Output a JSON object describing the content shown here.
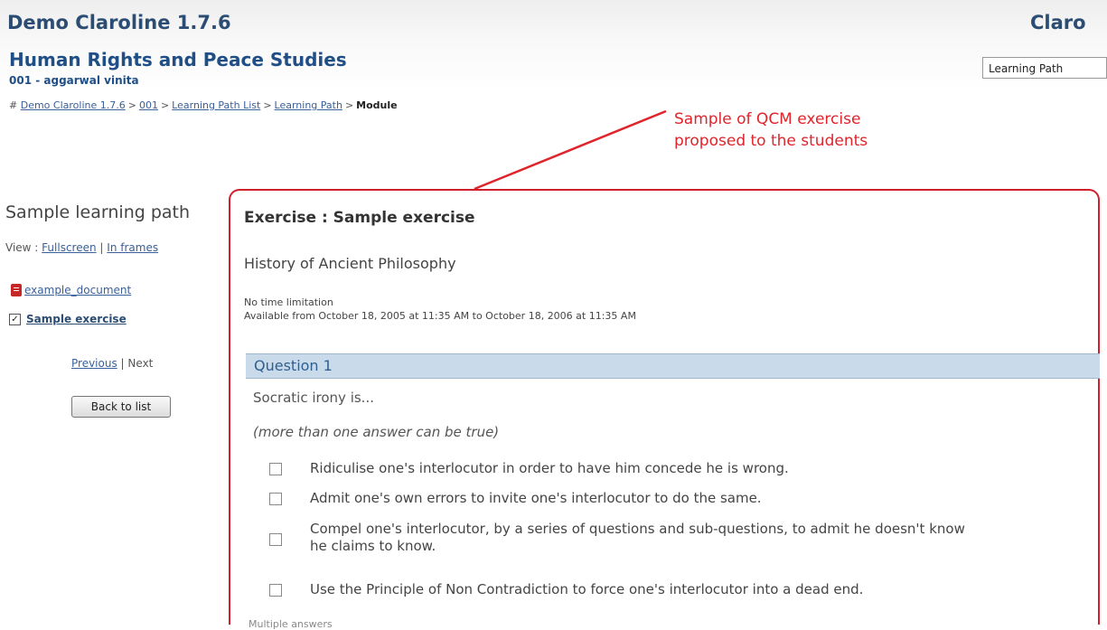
{
  "header": {
    "platform_title": "Demo Claroline 1.7.6",
    "platform_title_right": "Claro",
    "course_title": "Human Rights and Peace Studies",
    "course_code": "001 - aggarwal vinita",
    "tool_select_value": "Learning Path"
  },
  "breadcrumb": {
    "prefix": "#",
    "items": [
      "Demo Claroline 1.7.6",
      "001",
      "Learning Path List",
      "Learning Path"
    ],
    "separator": ">",
    "current": "Module"
  },
  "annotation": {
    "line1": "Sample of QCM exercise",
    "line2": "proposed to the students",
    "color": "#e0242b"
  },
  "sidebar": {
    "title": "Sample learning path",
    "view_prefix": "View :",
    "view_fullscreen": "Fullscreen",
    "view_sep": "|",
    "view_frames": "In frames",
    "items": [
      {
        "label": "example_document",
        "icon": "pdf-icon"
      },
      {
        "label": "Sample exercise",
        "icon": "checkbox-checked-icon",
        "check_glyph": "✓"
      }
    ],
    "previous": "Previous",
    "nav_sep": "|",
    "next": "Next",
    "back_button": "Back to list"
  },
  "exercise": {
    "title": "Exercise : Sample exercise",
    "description": "History of Ancient Philosophy",
    "time_limit": "No time limitation",
    "availability": "Available from October 18, 2005 at 11:35 AM to October 18, 2006 at 11:35 AM",
    "question_label": "Question 1",
    "question_text": "Socratic irony is...",
    "question_hint": "(more than one answer can be true)",
    "answers": [
      "Ridiculise one's interlocutor in order to have him concede he is wrong.",
      "Admit one's own errors to invite one's interlocutor to do the same.",
      "Compel one's interlocutor, by a series of questions and sub-questions, to admit he doesn't know",
      "he claims to know.",
      "Use the Principle of Non Contradiction to force one's interlocutor into a dead end."
    ],
    "question_type": "Multiple answers"
  },
  "colors": {
    "accent_red": "#d21f2b",
    "header_blue": "#1f4f86",
    "question_bar": "#c9dbea"
  }
}
